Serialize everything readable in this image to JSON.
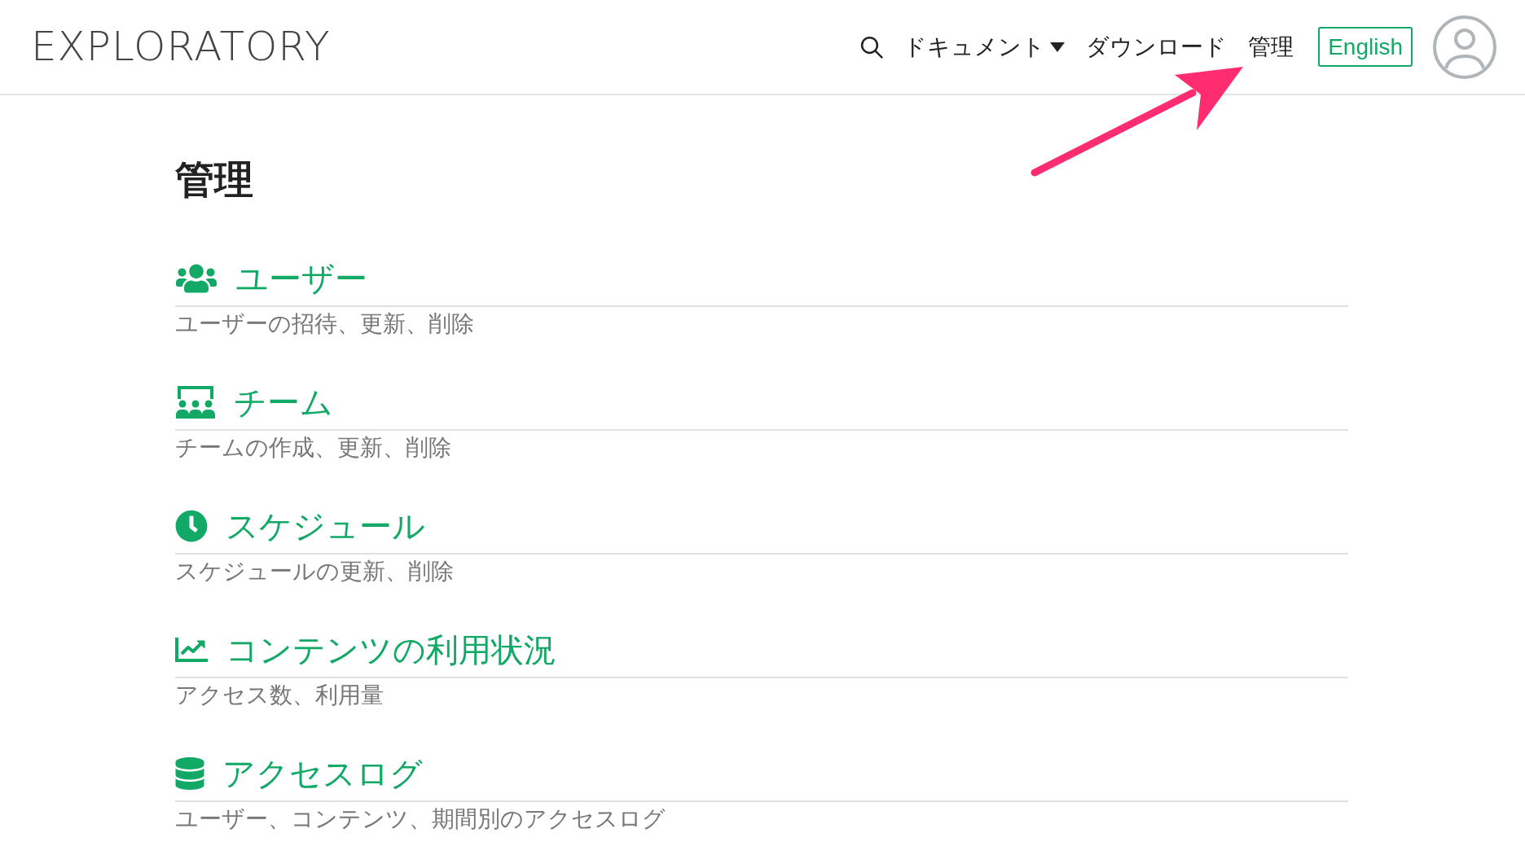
{
  "header": {
    "logo": "EXPLORATORY",
    "nav": [
      {
        "label": "ドキュメント",
        "kind": "dropdown"
      },
      {
        "label": "ダウンロード",
        "kind": "link"
      },
      {
        "label": "管理",
        "kind": "link"
      }
    ],
    "language_button": "English"
  },
  "page_title": "管理",
  "sections": [
    {
      "title": "ユーザー",
      "description": "ユーザーの招待、更新、削除"
    },
    {
      "title": "チーム",
      "description": "チームの作成、更新、削除"
    },
    {
      "title": "スケジュール",
      "description": "スケジュールの更新、削除"
    },
    {
      "title": "コンテンツの利用状況",
      "description": "アクセス数、利用量"
    },
    {
      "title": "アクセスログ",
      "description": "ユーザー、コンテンツ、期間別のアクセスログ"
    }
  ]
}
